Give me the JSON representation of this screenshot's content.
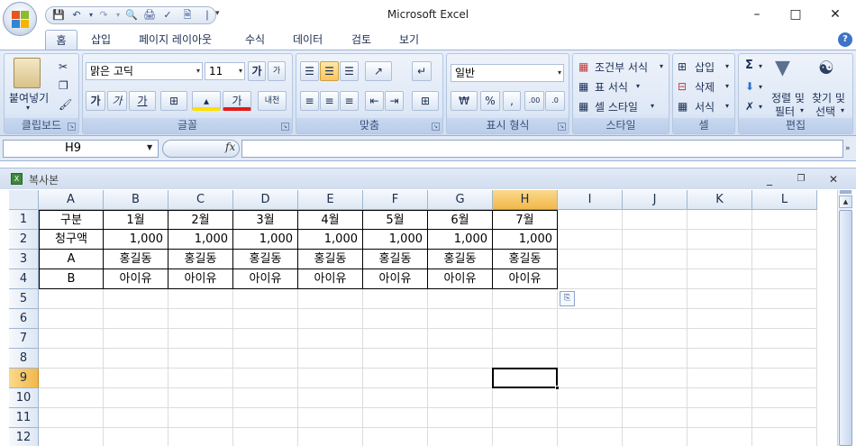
{
  "window": {
    "title": "Microsoft Excel"
  },
  "tabs": [
    {
      "label": "홈",
      "active": true
    },
    {
      "label": "삽입"
    },
    {
      "label": "페이지 레이아웃"
    },
    {
      "label": "수식"
    },
    {
      "label": "데이터"
    },
    {
      "label": "검토"
    },
    {
      "label": "보기"
    }
  ],
  "ribbon": {
    "clipboard": {
      "paste_label": "붙여넣기",
      "group_label": "클립보드"
    },
    "font": {
      "name": "맑은 고딕",
      "size": "11",
      "group_label": "글꼴"
    },
    "alignment": {
      "group_label": "맞춤"
    },
    "number": {
      "format": "일반",
      "group_label": "표시 형식"
    },
    "styles": {
      "conditional_label": "조건부 서식",
      "table_label": "표 서식",
      "cell_styles_label": "셀 스타일",
      "group_label": "스타일"
    },
    "cells": {
      "insert_label": "삽입",
      "delete_label": "삭제",
      "format_label": "서식",
      "group_label": "셀"
    },
    "editing": {
      "sort_label_1": "정렬 및",
      "sort_label_2": "필터",
      "find_label_1": "찾기 및",
      "find_label_2": "선택",
      "group_label": "편집"
    }
  },
  "formula_bar": {
    "name_box": "H9",
    "fx_label": "fx",
    "formula": ""
  },
  "workbook": {
    "title": "복사본"
  },
  "sheet": {
    "columns": [
      "A",
      "B",
      "C",
      "D",
      "E",
      "F",
      "G",
      "H",
      "I",
      "J",
      "K",
      "L"
    ],
    "selected_column": "H",
    "rows": [
      "1",
      "2",
      "3",
      "4",
      "5",
      "6",
      "7",
      "8",
      "9",
      "10",
      "11",
      "12"
    ],
    "selected_row": "9",
    "active_cell": "H9",
    "data": [
      [
        "구분",
        "1월",
        "2월",
        "3월",
        "4월",
        "5월",
        "6월",
        "7월"
      ],
      [
        "청구액",
        "1,000",
        "1,000",
        "1,000",
        "1,000",
        "1,000",
        "1,000",
        "1,000"
      ],
      [
        "A",
        "홍길동",
        "홍길동",
        "홍길동",
        "홍길동",
        "홍길동",
        "홍길동",
        "홍길동"
      ],
      [
        "B",
        "아이유",
        "아이유",
        "아이유",
        "아이유",
        "아이유",
        "아이유",
        "아이유"
      ]
    ]
  }
}
